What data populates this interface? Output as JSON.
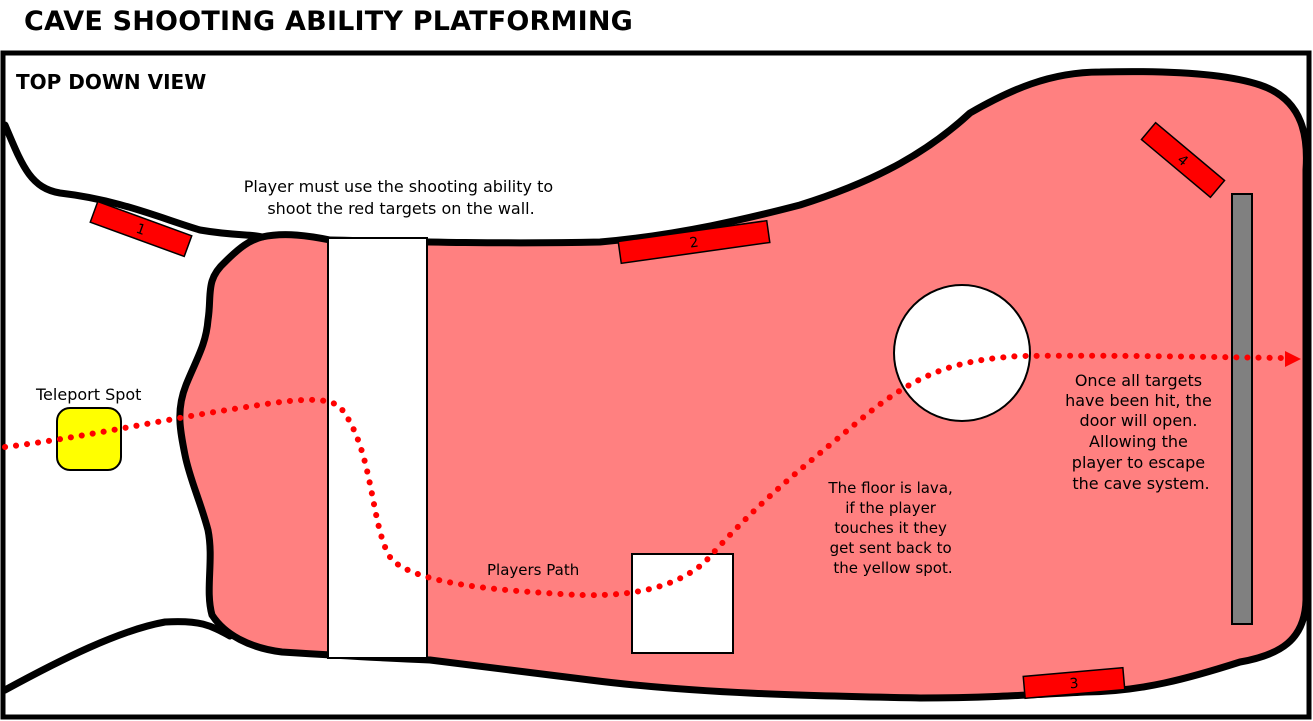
{
  "title": "CAVE SHOOTING ABILITY PLATFORMING",
  "view_label": "TOP DOWN VIEW",
  "teleport_label": "Teleport Spot",
  "instruction": [
    "Player must use the shooting ability to",
    "shoot the red targets on the wall."
  ],
  "path_label": "Players Path",
  "lava_note": [
    "The floor is lava,",
    "if the player",
    "touches it they",
    "get sent back to",
    "the yellow spot."
  ],
  "door_note": [
    "Once all targets",
    "have been hit, the",
    "door will open.",
    "Allowing the",
    "player to escape",
    "the cave system."
  ],
  "targets": [
    "1",
    "2",
    "3",
    "4"
  ],
  "colors": {
    "lava": "#ff8080",
    "target": "#ff0000",
    "teleport": "#ffff00",
    "door": "#808080",
    "path": "#ff0000",
    "outline": "#000000"
  }
}
